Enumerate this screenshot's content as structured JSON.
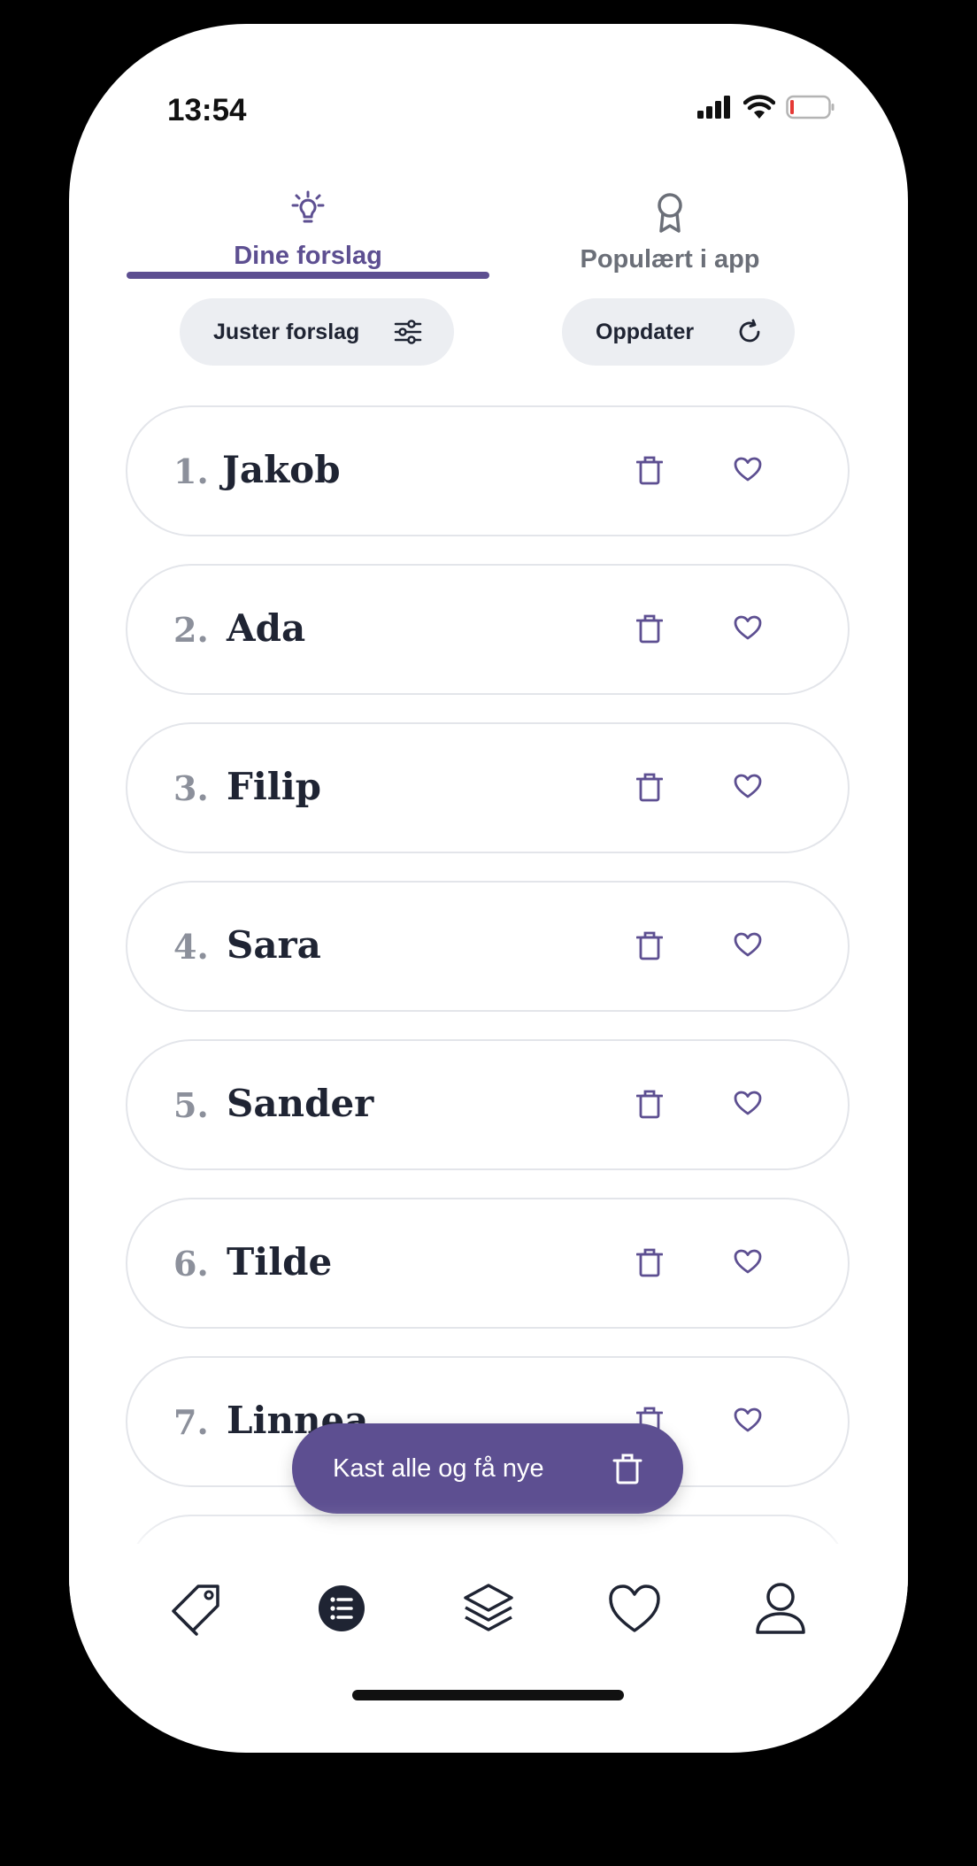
{
  "status_bar": {
    "time": "13:54"
  },
  "tabs": [
    {
      "label": "Dine forslag",
      "icon": "lightbulb-icon",
      "active": true
    },
    {
      "label": "Populært i app",
      "icon": "award-icon",
      "active": false
    }
  ],
  "actions": {
    "adjust_label": "Juster forslag",
    "update_label": "Oppdater"
  },
  "suggestions": [
    {
      "number": "1.",
      "name": "Jakob"
    },
    {
      "number": "2.",
      "name": "Ada"
    },
    {
      "number": "3.",
      "name": "Filip"
    },
    {
      "number": "4.",
      "name": "Sara"
    },
    {
      "number": "5.",
      "name": "Sander"
    },
    {
      "number": "6.",
      "name": "Tilde"
    },
    {
      "number": "7.",
      "name": "Linnea"
    }
  ],
  "fab": {
    "label": "Kast alle og få nye"
  },
  "bottom_nav": [
    {
      "icon": "tag-icon"
    },
    {
      "icon": "list-icon",
      "active": true
    },
    {
      "icon": "layers-icon"
    },
    {
      "icon": "heart-icon"
    },
    {
      "icon": "user-icon"
    }
  ],
  "colors": {
    "accent": "#5d4f91",
    "text": "#1f2433",
    "muted": "#8c909b"
  }
}
